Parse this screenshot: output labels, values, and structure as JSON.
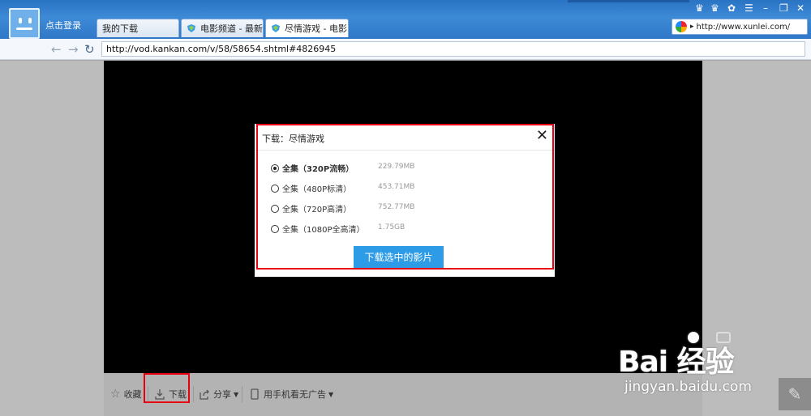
{
  "titlebar": {
    "login": "点击登录",
    "tabs": [
      {
        "label": "我的下载"
      },
      {
        "label": "电影频道 - 最新..."
      },
      {
        "label": "尽情游戏 - 电影 ..."
      }
    ],
    "right_url": "http://www.xunlei.com/"
  },
  "navbar": {
    "address": "http://vod.kankan.com/v/58/58654.shtml#4826945"
  },
  "dialog": {
    "title": "下载：尽情游戏",
    "options": [
      {
        "label": "全集（320P流畅）",
        "size": "229.79MB",
        "selected": true
      },
      {
        "label": "全集（480P标清）",
        "size": "453.71MB",
        "selected": false
      },
      {
        "label": "全集（720P高清）",
        "size": "752.77MB",
        "selected": false
      },
      {
        "label": "全集（1080P全高清）",
        "size": "1.75GB",
        "selected": false
      }
    ],
    "download_button": "下载选中的影片"
  },
  "controls": {
    "favorite": "收藏",
    "download": "下载",
    "share": "分享",
    "mobile": "用手机看无广告"
  },
  "watermark": {
    "brand": "Bai  经验",
    "site": "jingyan.baidu.com"
  }
}
